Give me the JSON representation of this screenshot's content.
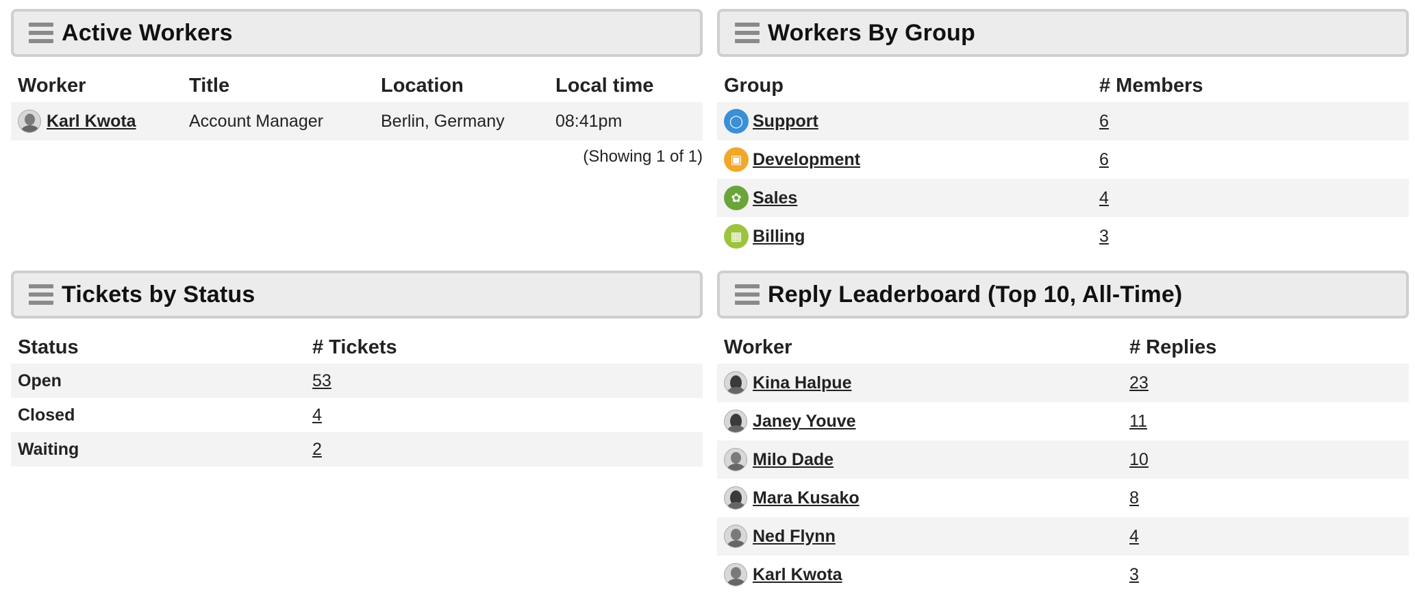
{
  "active_workers": {
    "title": "Active Workers",
    "columns": [
      "Worker",
      "Title",
      "Location",
      "Local time"
    ],
    "rows": [
      {
        "worker": "Karl Kwota",
        "title": "Account Manager",
        "location": "Berlin, Germany",
        "local_time": "08:41pm"
      }
    ],
    "footer": "(Showing 1 of 1)"
  },
  "workers_by_group": {
    "title": "Workers By Group",
    "columns": [
      "Group",
      "# Members"
    ],
    "rows": [
      {
        "group": "Support",
        "members": "6",
        "icon": "surprised-face-icon",
        "color": "#3a8fd6"
      },
      {
        "group": "Development",
        "members": "6",
        "icon": "robot-icon",
        "color": "#f0a82a"
      },
      {
        "group": "Sales",
        "members": "4",
        "icon": "flower-icon",
        "color": "#6aa53a"
      },
      {
        "group": "Billing",
        "members": "3",
        "icon": "bank-icon",
        "color": "#9cc43f"
      }
    ]
  },
  "tickets_by_status": {
    "title": "Tickets by Status",
    "columns": [
      "Status",
      "# Tickets"
    ],
    "rows": [
      {
        "status": "Open",
        "tickets": "53"
      },
      {
        "status": "Closed",
        "tickets": "4"
      },
      {
        "status": "Waiting",
        "tickets": "2"
      }
    ]
  },
  "reply_leaderboard": {
    "title": "Reply Leaderboard (Top 10, All-Time)",
    "columns": [
      "Worker",
      "# Replies"
    ],
    "rows": [
      {
        "worker": "Kina Halpue",
        "replies": "23",
        "avatar": "female"
      },
      {
        "worker": "Janey Youve",
        "replies": "11",
        "avatar": "female"
      },
      {
        "worker": "Milo Dade",
        "replies": "10",
        "avatar": "male"
      },
      {
        "worker": "Mara Kusako",
        "replies": "8",
        "avatar": "female"
      },
      {
        "worker": "Ned Flynn",
        "replies": "4",
        "avatar": "male"
      },
      {
        "worker": "Karl Kwota",
        "replies": "3",
        "avatar": "male"
      }
    ]
  }
}
